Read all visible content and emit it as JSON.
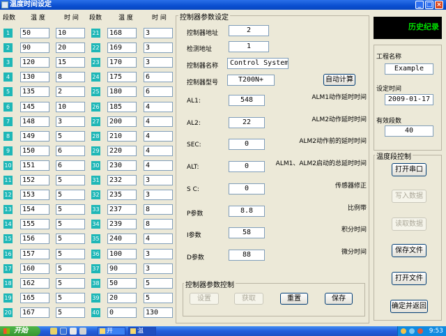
{
  "window": {
    "title": "温度时间设定"
  },
  "table": {
    "headers": {
      "seg": "段数",
      "temp": "温 度",
      "time": "时 间"
    },
    "left": [
      {
        "n": "1",
        "temp": "50",
        "time": "10"
      },
      {
        "n": "2",
        "temp": "90",
        "time": "20"
      },
      {
        "n": "3",
        "temp": "120",
        "time": "15"
      },
      {
        "n": "4",
        "temp": "130",
        "time": "8"
      },
      {
        "n": "5",
        "temp": "135",
        "time": "2"
      },
      {
        "n": "6",
        "temp": "145",
        "time": "10"
      },
      {
        "n": "7",
        "temp": "148",
        "time": "3"
      },
      {
        "n": "8",
        "temp": "149",
        "time": "5"
      },
      {
        "n": "9",
        "temp": "150",
        "time": "6"
      },
      {
        "n": "10",
        "temp": "151",
        "time": "6"
      },
      {
        "n": "11",
        "temp": "152",
        "time": "5"
      },
      {
        "n": "12",
        "temp": "153",
        "time": "5"
      },
      {
        "n": "13",
        "temp": "154",
        "time": "5"
      },
      {
        "n": "14",
        "temp": "155",
        "time": "5"
      },
      {
        "n": "15",
        "temp": "156",
        "time": "5"
      },
      {
        "n": "16",
        "temp": "157",
        "time": "5"
      },
      {
        "n": "17",
        "temp": "160",
        "time": "5"
      },
      {
        "n": "18",
        "temp": "162",
        "time": "5"
      },
      {
        "n": "19",
        "temp": "165",
        "time": "5"
      },
      {
        "n": "20",
        "temp": "167",
        "time": "5"
      }
    ],
    "right": [
      {
        "n": "21",
        "temp": "168",
        "time": "3"
      },
      {
        "n": "22",
        "temp": "169",
        "time": "3"
      },
      {
        "n": "23",
        "temp": "170",
        "time": "3"
      },
      {
        "n": "24",
        "temp": "175",
        "time": "6"
      },
      {
        "n": "25",
        "temp": "180",
        "time": "6"
      },
      {
        "n": "26",
        "temp": "185",
        "time": "4"
      },
      {
        "n": "27",
        "temp": "200",
        "time": "4"
      },
      {
        "n": "28",
        "temp": "210",
        "time": "4"
      },
      {
        "n": "29",
        "temp": "220",
        "time": "4"
      },
      {
        "n": "30",
        "temp": "230",
        "time": "4"
      },
      {
        "n": "31",
        "temp": "232",
        "time": "3"
      },
      {
        "n": "32",
        "temp": "235",
        "time": "3"
      },
      {
        "n": "33",
        "temp": "237",
        "time": "8"
      },
      {
        "n": "34",
        "temp": "239",
        "time": "8"
      },
      {
        "n": "35",
        "temp": "240",
        "time": "4"
      },
      {
        "n": "36",
        "temp": "100",
        "time": "3"
      },
      {
        "n": "37",
        "temp": "90",
        "time": "3"
      },
      {
        "n": "38",
        "temp": "50",
        "time": "5"
      },
      {
        "n": "39",
        "temp": "20",
        "time": "5"
      },
      {
        "n": "40",
        "temp": "0",
        "time": "130"
      }
    ]
  },
  "controller": {
    "group_title": "控制器参数设定",
    "address_label": "控制器地址",
    "address": "2",
    "detect_label": "检测地址",
    "detect": "1",
    "name_label": "控制器名称",
    "name": "Control System",
    "model_label": "控制器型号",
    "model": "T200N+",
    "auto_calc": "自动计算",
    "params": [
      {
        "label": "AL1:",
        "value": "548",
        "desc": "ALM1动作延时时间"
      },
      {
        "label": "AL2:",
        "value": "22",
        "desc": "ALM2动作延时时间"
      },
      {
        "label": "SEC:",
        "value": "0",
        "desc": "ALM2动作前的延时时间"
      },
      {
        "label": "ALT:",
        "value": "0",
        "desc": "ALM1、ALM2启动的总延时时间"
      },
      {
        "label": "S C:",
        "value": "0",
        "desc": "传感器修正"
      },
      {
        "label": "P参数",
        "value": "8.8",
        "desc": "比例带"
      },
      {
        "label": "I参数",
        "value": "58",
        "desc": "积分时间"
      },
      {
        "label": "D参数",
        "value": "88",
        "desc": "微分时间"
      }
    ],
    "control_group_title": "控制器参数控制",
    "btn_set": "设置",
    "btn_get": "获取",
    "btn_reset": "重置",
    "btn_save": "保存"
  },
  "side": {
    "history": "历史纪录",
    "project_label": "工程名称",
    "project": "Example",
    "date_label": "设定时间",
    "date": "2009-01-17",
    "segments_label": "有效段数",
    "segments": "40",
    "group_title": "温度段控制",
    "open_port": "打开串口",
    "write_data": "写入数据",
    "read_data": "读取数据",
    "save_file": "保存文件",
    "open_file": "打开文件",
    "confirm_return": "确定并返回"
  },
  "taskbar": {
    "start": "开始",
    "item1": "开",
    "item2": "温",
    "clock": "9:53"
  }
}
